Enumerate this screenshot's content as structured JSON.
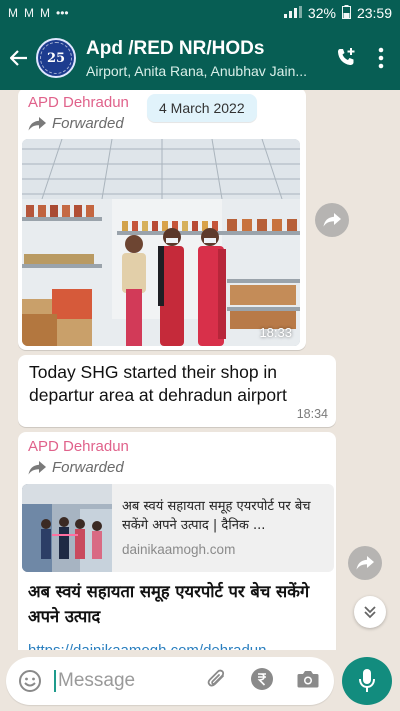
{
  "status": {
    "left_icons": [
      "gmail-icon",
      "gmail-icon",
      "gmail-icon",
      "more-dots-icon"
    ],
    "battery": "32%",
    "time": "23:59"
  },
  "header": {
    "avatar_text": "25",
    "title": "Apd /RED NR/HODs",
    "subtitle": "Airport, Anita Rana, Anubhav Jain..."
  },
  "chat": {
    "date_chip": "4 March 2022",
    "msg1": {
      "sender": "APD Dehradun",
      "forwarded": "Forwarded",
      "photo_time": "18:33"
    },
    "msg2": {
      "text": "Today SHG started their shop in departur area at dehradun airport",
      "time": "18:34"
    },
    "msg3": {
      "sender": "APD Dehradun",
      "forwarded": "Forwarded",
      "link_title": "अब स्वयं सहायता समूह एयरपोर्ट पर बेच सकेंगे अपने उत्पाद | दैनिक ...",
      "link_domain": "dainikaamogh.com",
      "body": "अब स्वयं सहायता समूह एयरपोर्ट पर बेच सकेंगे अपने उत्पाद",
      "url_peek": "https://dainikaamogh.com/dehradun"
    }
  },
  "input": {
    "placeholder": "Message"
  },
  "colors": {
    "header": "#075e54",
    "sender": "#e0628b",
    "mic": "#128c7e"
  }
}
